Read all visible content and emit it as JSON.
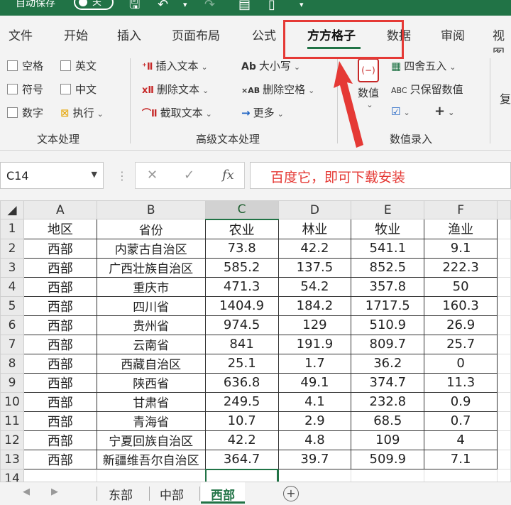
{
  "titlebar": {
    "autosave_label": "自动保存",
    "toggle_state": "关"
  },
  "ribbon_tabs": [
    {
      "label": "文件"
    },
    {
      "label": "开始"
    },
    {
      "label": "插入"
    },
    {
      "label": "页面布局"
    },
    {
      "label": "公式"
    },
    {
      "label": "方方格子"
    },
    {
      "label": "数据"
    },
    {
      "label": "审阅"
    },
    {
      "label": "视图"
    }
  ],
  "ribbon": {
    "text_group": {
      "label": "文本处理",
      "items": [
        "空格",
        "英文",
        "符号",
        "中文",
        "数字",
        "执行"
      ]
    },
    "adv_group": {
      "label": "高级文本处理",
      "items": [
        "插入文本",
        "删除文本",
        "截取文本",
        "大小写",
        "删除空格",
        "更多"
      ]
    },
    "num_group": {
      "label": "数值录入",
      "big_button": "数值",
      "items": [
        "四舍五入",
        "只保留数值"
      ],
      "partial_label": "复"
    }
  },
  "formula_bar": {
    "name_box": "C14",
    "fx_label": "fx",
    "content": "百度它，即可下载安装"
  },
  "sheet": {
    "columns": [
      "A",
      "B",
      "C",
      "D",
      "E",
      "F"
    ],
    "rows": [
      {
        "n": "1",
        "cells": [
          "地区",
          "省份",
          "农业",
          "林业",
          "牧业",
          "渔业"
        ]
      },
      {
        "n": "2",
        "cells": [
          "西部",
          "内蒙古自治区",
          "73.8",
          "42.2",
          "541.1",
          "9.1"
        ]
      },
      {
        "n": "3",
        "cells": [
          "西部",
          "广西壮族自治区",
          "585.2",
          "137.5",
          "852.5",
          "222.3"
        ]
      },
      {
        "n": "4",
        "cells": [
          "西部",
          "重庆市",
          "471.3",
          "54.2",
          "357.8",
          "50"
        ]
      },
      {
        "n": "5",
        "cells": [
          "西部",
          "四川省",
          "1404.9",
          "184.2",
          "1717.5",
          "160.3"
        ]
      },
      {
        "n": "6",
        "cells": [
          "西部",
          "贵州省",
          "974.5",
          "129",
          "510.9",
          "26.9"
        ]
      },
      {
        "n": "7",
        "cells": [
          "西部",
          "云南省",
          "841",
          "191.9",
          "809.7",
          "25.7"
        ]
      },
      {
        "n": "8",
        "cells": [
          "西部",
          "西藏自治区",
          "25.1",
          "1.7",
          "36.2",
          "0"
        ]
      },
      {
        "n": "9",
        "cells": [
          "西部",
          "陕西省",
          "636.8",
          "49.1",
          "374.7",
          "11.3"
        ]
      },
      {
        "n": "10",
        "cells": [
          "西部",
          "甘肃省",
          "249.5",
          "4.1",
          "232.8",
          "0.9"
        ]
      },
      {
        "n": "11",
        "cells": [
          "西部",
          "青海省",
          "10.7",
          "2.9",
          "68.5",
          "0.7"
        ]
      },
      {
        "n": "12",
        "cells": [
          "西部",
          "宁夏回族自治区",
          "42.2",
          "4.8",
          "109",
          "4"
        ]
      },
      {
        "n": "13",
        "cells": [
          "西部",
          "新疆维吾尔自治区",
          "364.7",
          "39.7",
          "509.9",
          "7.1"
        ]
      },
      {
        "n": "14",
        "cells": [
          "",
          "",
          "",
          "",
          "",
          ""
        ]
      }
    ],
    "selected_column": "C",
    "active_cell": "C14"
  },
  "sheet_tabs": [
    {
      "label": "东部"
    },
    {
      "label": "中部"
    },
    {
      "label": "西部"
    }
  ],
  "colors": {
    "accent": "#217346",
    "highlight": "#e53935"
  }
}
